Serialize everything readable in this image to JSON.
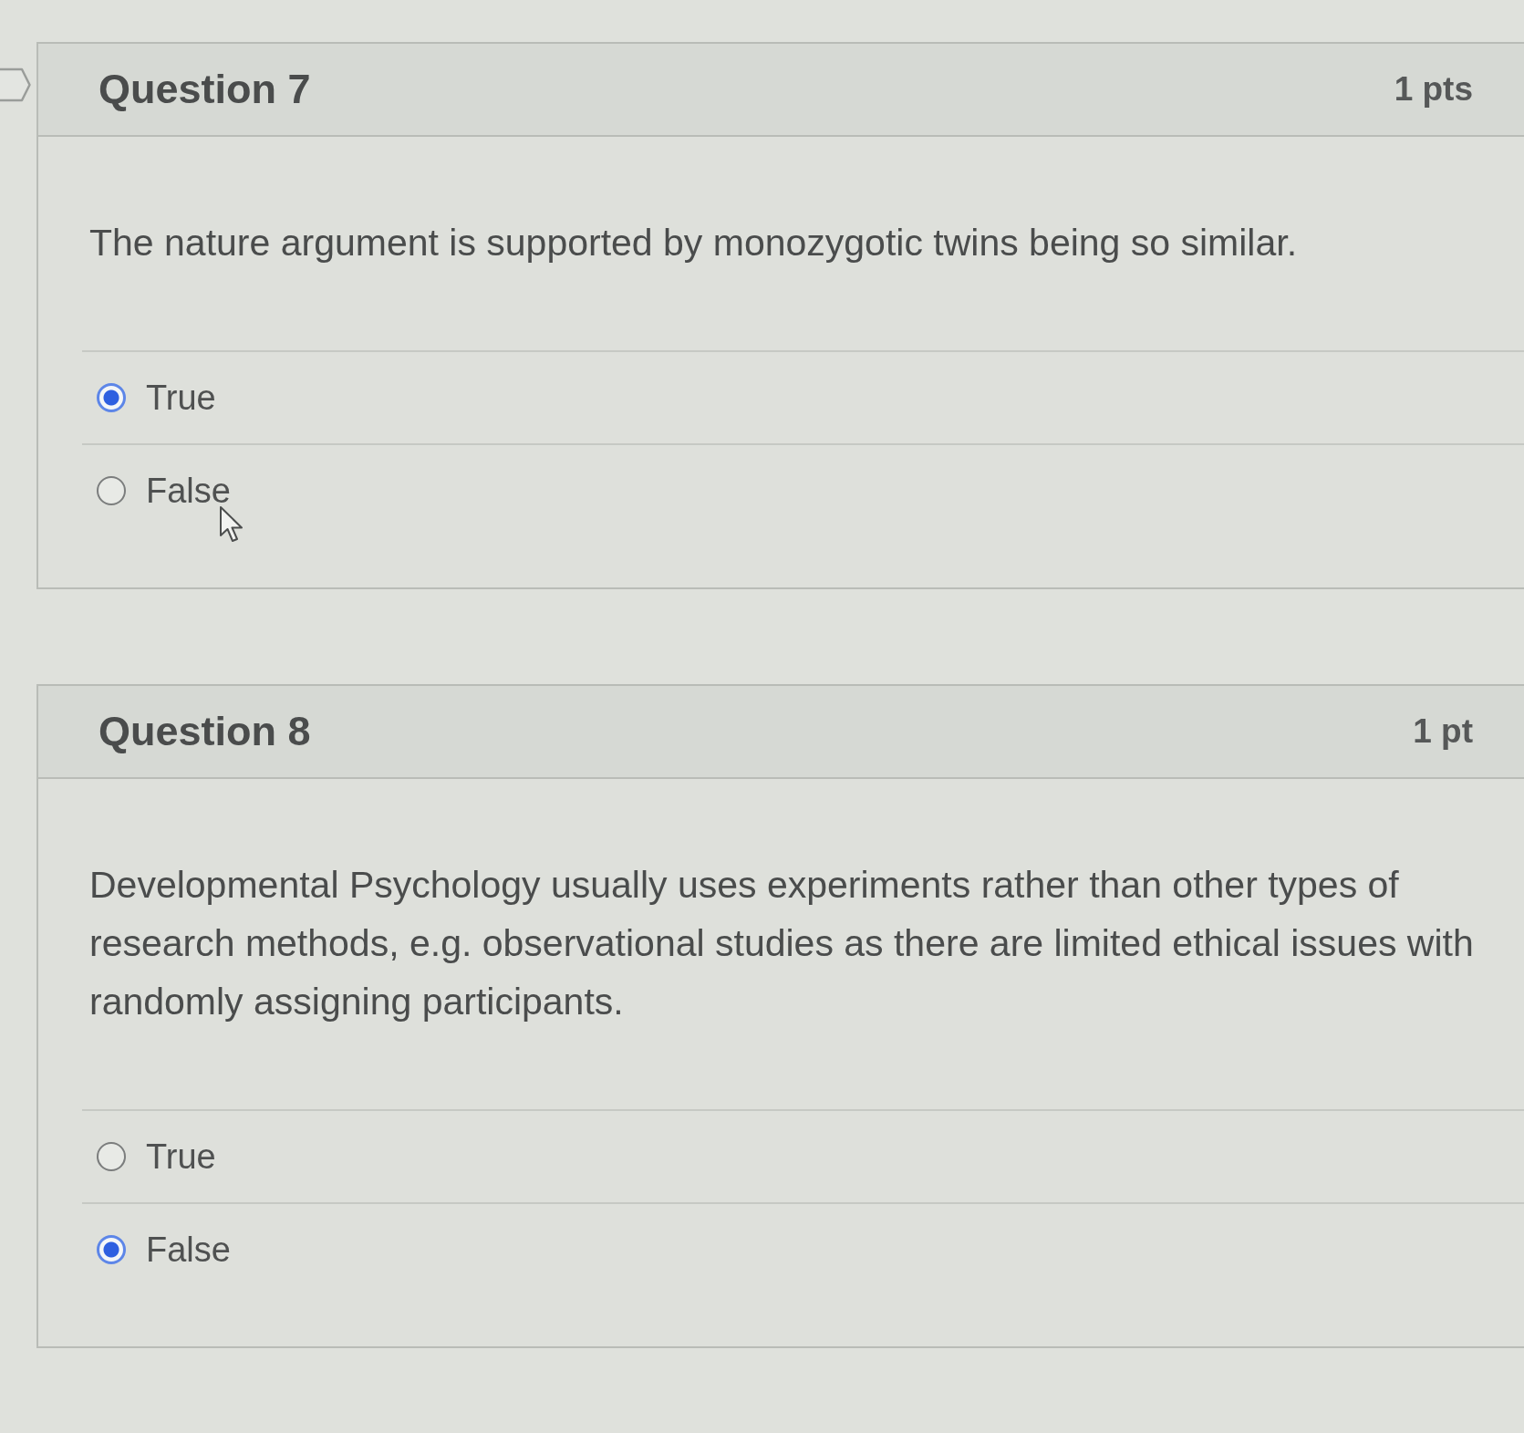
{
  "questions": [
    {
      "title": "Question 7",
      "points": "1 pts",
      "text": "The nature argument is supported by monozygotic twins being so similar.",
      "options": [
        {
          "label": "True",
          "selected": true
        },
        {
          "label": "False",
          "selected": false
        }
      ]
    },
    {
      "title": "Question 8",
      "points": "1 pt",
      "text": "Developmental Psychology usually uses experiments rather than other types of research methods, e.g. observational studies as there are limited ethical issues with randomly assigning participants.",
      "options": [
        {
          "label": "True",
          "selected": false
        },
        {
          "label": "False",
          "selected": true
        }
      ]
    }
  ]
}
